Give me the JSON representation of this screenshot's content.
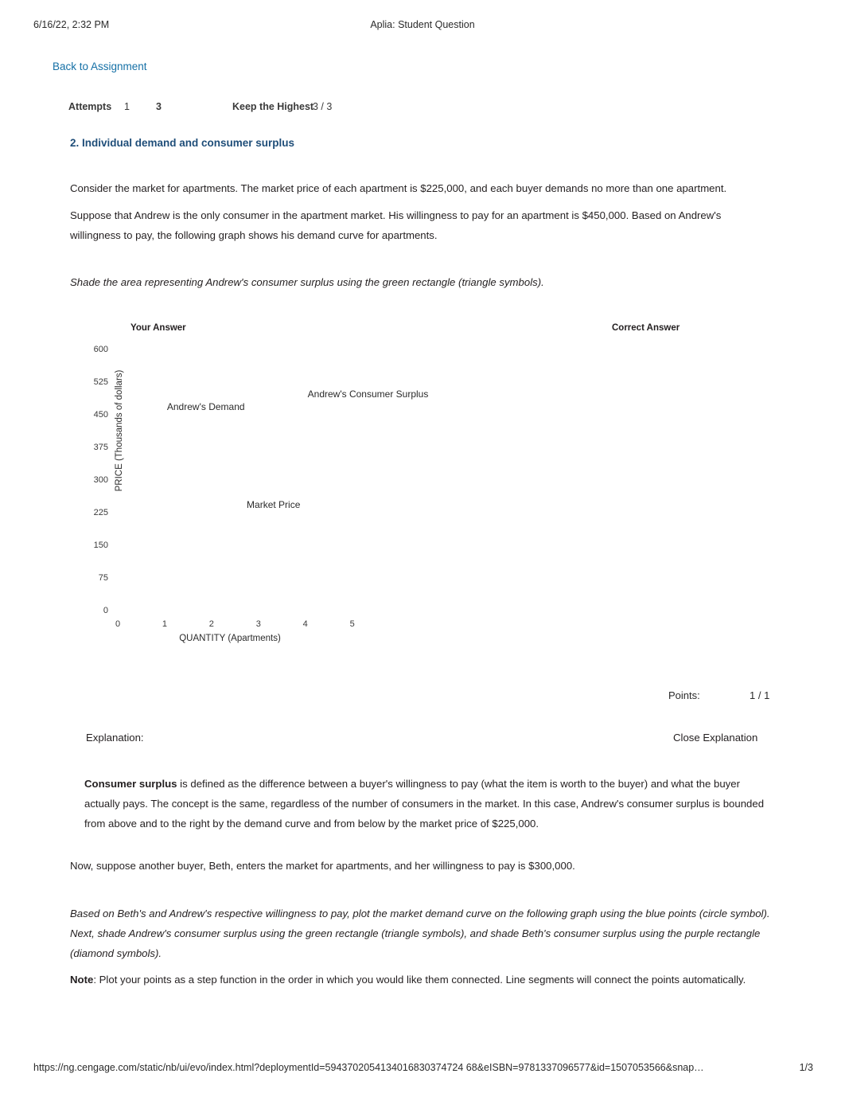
{
  "print_header": {
    "date": "6/16/22, 2:32 PM",
    "title": "Aplia: Student Question"
  },
  "print_footer": {
    "url": "https://ng.cengage.com/static/nb/ui/evo/index.html?deploymentId=5943702054134016830374724 68&eISBN=9781337096577&id=1507053566&snap…",
    "page": "1/3"
  },
  "nav": {
    "back_link": "Back to Assignment"
  },
  "attempts": {
    "label": "Attempts",
    "first": "1",
    "second": "3",
    "keep_label": "Keep the Highest",
    "keep_value": "3 / 3"
  },
  "question": {
    "title": "2. Individual demand and consumer surplus",
    "intro": "Consider the market for apartments. The market price of each apartment is $225,000, and each buyer demands no more than one apartment.",
    "andrew": "Suppose that Andrew is the only consumer in the apartment market. His willingness to pay for an apartment is $450,000. Based on Andrew's willingness to pay, the following graph shows his demand curve for apartments.",
    "shade_instruction": "Shade the area representing Andrew's consumer surplus using the green rectangle (triangle symbols)."
  },
  "graph": {
    "your_answer_header": "Your Answer",
    "correct_answer_header": "Correct Answer"
  },
  "grading": {
    "points_label": "Points:",
    "points_value": "1 / 1"
  },
  "explanation": {
    "label": "Explanation:",
    "close_label": "Close Explanation",
    "consumer_surplus_bold": "Consumer surplus",
    "consumer_surplus_rest": " is defined as the difference between a buyer's willingness to pay (what the item is worth to the buyer) and what the buyer actually pays. The concept is the same, regardless of the number of consumers in the market. In this case, Andrew's consumer surplus is bounded from above and to the right by the demand curve and from below by the market price of $225,000.",
    "beth": "Now, suppose another buyer, Beth, enters the market for apartments, and her willingness to pay is $300,000.",
    "plot_instruction": "Based on Beth's and Andrew's respective willingness to pay, plot the market demand curve on the following graph using the blue points (circle symbol). Next, shade Andrew's consumer surplus using the green rectangle (triangle symbols), and shade Beth's consumer surplus using the purple rectangle (diamond symbols).",
    "note_bold": "Note",
    "note_rest": ": Plot your points as a step function in the order in which you would like them connected. Line segments will connect the points automatically."
  },
  "chart_data": {
    "type": "line",
    "title": "",
    "xlabel": "QUANTITY (Apartments)",
    "ylabel": "PRICE (Thousands of dollars)",
    "xlim": [
      0,
      5.6
    ],
    "ylim": [
      0,
      600
    ],
    "xticks": [
      0,
      1,
      2,
      3,
      4,
      5
    ],
    "xtick_labels": [
      "0",
      "1",
      "2",
      "3",
      "4",
      "5"
    ],
    "yticks": [
      0,
      75,
      150,
      225,
      300,
      375,
      450,
      525,
      600
    ],
    "ytick_labels": [
      "0",
      "75",
      "150",
      "225",
      "300",
      "375",
      "450",
      "525",
      "600"
    ],
    "grid": false,
    "legend": "inline-labels",
    "annotations": [
      {
        "text": "Andrew's Demand",
        "x": 1.05,
        "y": 468
      },
      {
        "text": "Andrew's Consumer Surplus",
        "x": 4.05,
        "y": 497
      },
      {
        "text": "Market Price",
        "x": 2.75,
        "y": 243
      }
    ],
    "series": [
      {
        "name": "Andrew's Demand",
        "values": []
      },
      {
        "name": "Andrew's Consumer Surplus",
        "values": []
      },
      {
        "name": "Market Price",
        "values": []
      }
    ],
    "market_price": 225,
    "andrew_willingness_to_pay": 450,
    "beth_willingness_to_pay": 300
  }
}
